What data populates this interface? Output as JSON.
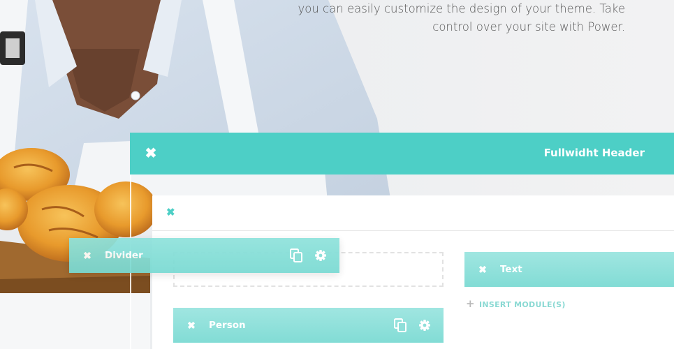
{
  "hero": {
    "line1": "you can easily customize the design of your theme. Take",
    "line2": "control over your site with Power."
  },
  "fullwidth_header": {
    "title": "Fullwidht Header",
    "close_icon": "✖"
  },
  "row": {
    "close_icon": "✖"
  },
  "modules": {
    "divider": {
      "label": "Divider",
      "close_icon": "✖"
    },
    "person": {
      "label": "Person",
      "close_icon": "✖"
    },
    "text": {
      "label": "Text",
      "close_icon": "✖"
    }
  },
  "insert_module": {
    "icon": "+",
    "label": "INSERT MODULE(S)"
  },
  "colors": {
    "accent": "#4dcfc6",
    "module_light": "#a0e6e1",
    "insert_text": "#8ad9d3"
  }
}
